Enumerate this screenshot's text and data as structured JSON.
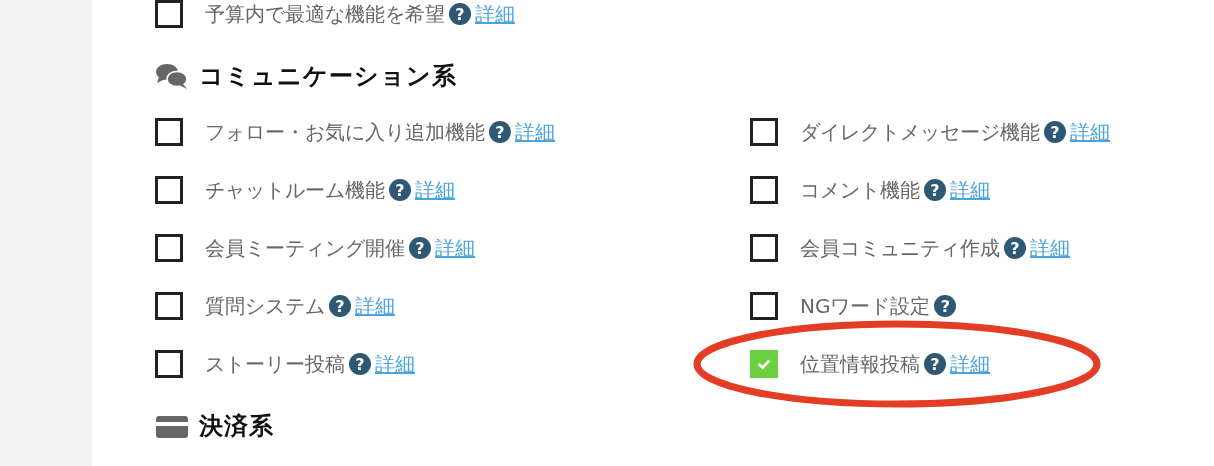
{
  "prev_items": [
    {
      "label": "予算内で最適な機能を希望",
      "checked": false,
      "help": "?",
      "link": "詳細"
    }
  ],
  "sections": [
    {
      "title": "コミュニケーション系",
      "kind": "chat",
      "items": [
        {
          "label": "フォロー・お気に入り追加機能",
          "checked": false,
          "help": "?",
          "link": "詳細"
        },
        {
          "label": "ダイレクトメッセージ機能",
          "checked": false,
          "help": "?",
          "link": "詳細"
        },
        {
          "label": "チャットルーム機能",
          "checked": false,
          "help": "?",
          "link": "詳細"
        },
        {
          "label": "コメント機能",
          "checked": false,
          "help": "?",
          "link": "詳細"
        },
        {
          "label": "会員ミーティング開催",
          "checked": false,
          "help": "?",
          "link": "詳細"
        },
        {
          "label": "会員コミュニティ作成",
          "checked": false,
          "help": "?",
          "link": "詳細"
        },
        {
          "label": "質問システム",
          "checked": false,
          "help": "?",
          "link": "詳細"
        },
        {
          "label": "NGワード設定",
          "checked": false,
          "help": "?"
        },
        {
          "label": "ストーリー投稿",
          "checked": false,
          "help": "?",
          "link": "詳細"
        },
        {
          "label": "位置情報投稿",
          "checked": true,
          "circled": true,
          "help": "?",
          "link": "詳細"
        }
      ]
    },
    {
      "title": "決済系",
      "kind": "payment"
    }
  ]
}
